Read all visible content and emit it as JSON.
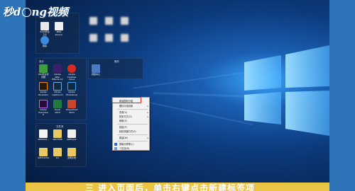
{
  "watermark": {
    "brand_left": "秒",
    "brand_mid": "d",
    "brand_right": "ng视频"
  },
  "top_panel": {
    "icons": [
      {
        "label": "Microsoft Edge",
        "color": "#2e8ae6"
      },
      {
        "label": "2345安全卫士",
        "color": "#7ab6e8"
      },
      {
        "label": "MPD Runner",
        "color": "#e84c3d"
      },
      {
        "label": "网易",
        "color": "#3b8cde"
      }
    ]
  },
  "design_panel": {
    "title": "设计",
    "icons": [
      {
        "label": "360安全浏览器",
        "color": "#3d9e3a"
      },
      {
        "label": "Adobe After Effects CC",
        "color": "#3b1f6b"
      },
      {
        "label": "Adobe Creative Cloud",
        "color": "#da2a1f"
      },
      {
        "label": "Adobe Illustrator",
        "color": "#e98a12"
      },
      {
        "label": "Adobe Lightroom",
        "color": "#2d5a8e"
      },
      {
        "label": "Adobe Photoshop",
        "color": "#1c6fb5"
      },
      {
        "label": "Adobe Premiere P",
        "color": "#5a2a8a"
      },
      {
        "label": "Excel 2013",
        "color": "#1e7a3e"
      },
      {
        "label": "PowerPoint 2013",
        "color": "#c9462b"
      }
    ]
  },
  "media_panel": {
    "title": "娱乐",
    "icons": [
      {
        "label": "视频中心",
        "color": "#4a7ac2"
      }
    ]
  },
  "files_panel": {
    "title": "文件夹",
    "icons": [
      {
        "label": "3DMAXX...",
        "color": "#e8c860"
      },
      {
        "label": "ARCTIME",
        "color": "#e8c860"
      },
      {
        "label": "GifPlayer",
        "color": "#e8c860"
      },
      {
        "label": "GPUCache",
        "color": "#e8c860"
      },
      {
        "label": "svr",
        "color": "#e8c860"
      },
      {
        "label": "说明文档",
        "color": "#e8c860"
      }
    ]
  },
  "context_menu": {
    "items": [
      {
        "label": "新建图标分组",
        "submenu": false,
        "highlighted": true
      },
      {
        "label": "图标分组设置",
        "submenu": true
      },
      {
        "label": "查看(V)",
        "submenu": true
      },
      {
        "label": "排序方式(O)",
        "submenu": true
      },
      {
        "label": "刷新(E)",
        "submenu": false
      },
      {
        "label": "粘贴(P)",
        "submenu": false
      },
      {
        "label": "粘贴快捷方式(S)",
        "submenu": false
      },
      {
        "label": "新建(W)",
        "submenu": true
      },
      {
        "label": "屏幕分辨率(C)",
        "submenu": false
      },
      {
        "label": "个性化(R)",
        "submenu": false
      }
    ],
    "accent_color": "#e0201a"
  },
  "subtitle": {
    "text": "三 进入页面后，单击右键点击新建标签项"
  },
  "colors": {
    "frame": "#2e74b8",
    "subtitle_bar": "#e9c445",
    "highlight": "#e0201a"
  }
}
